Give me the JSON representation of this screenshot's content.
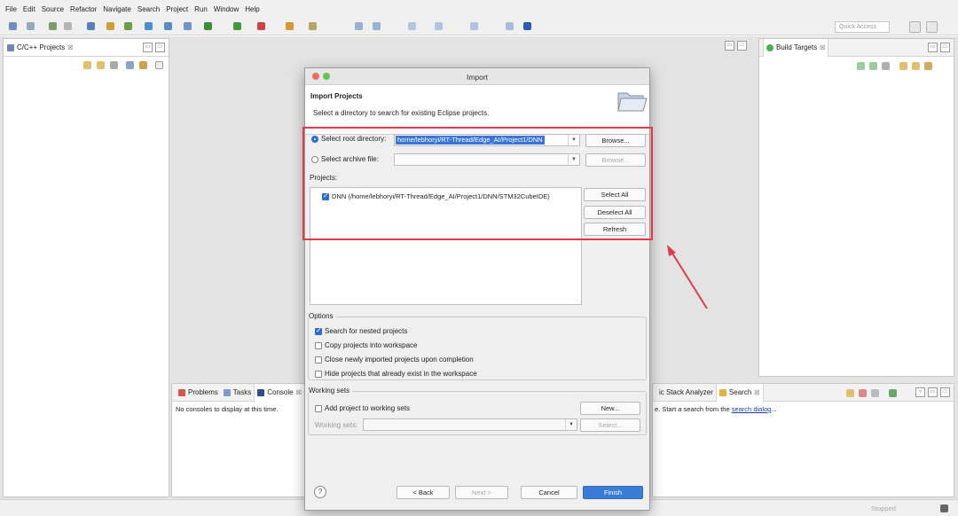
{
  "menubar": [
    "File",
    "Edit",
    "Source",
    "Refactor",
    "Navigate",
    "Search",
    "Project",
    "Run",
    "Window",
    "Help"
  ],
  "toolbar": {
    "quick_access_placeholder": "Quick Access"
  },
  "project_explorer": {
    "tab": "C/C++ Projects",
    "close": "☒"
  },
  "build_targets": {
    "tab": "Build Targets",
    "close": "☒"
  },
  "bottom_left": {
    "tabs": [
      "Problems",
      "Tasks",
      "Console"
    ],
    "active_tab": "Console",
    "empty_text": "No consoles to display at this time."
  },
  "bottom_right": {
    "tabs": [
      "ic Stack Analyzer",
      "Search"
    ],
    "text_prefix": "e. Start a search from the ",
    "link": "search dialog",
    "text_suffix": "..."
  },
  "status": {
    "text": "Stopped"
  },
  "dialog": {
    "title": "Import",
    "header_title": "Import Projects",
    "header_desc": "Select a directory to search for existing Eclipse projects.",
    "root_dir_label": "Select root directory:",
    "root_dir_value": "home/lebhoryi/RT-Thread/Edge_AI/Project1/DNN",
    "archive_label": "Select archive file:",
    "archive_value": "",
    "browse_label": "Browse...",
    "projects_label": "Projects:",
    "projects": [
      {
        "label": "DNN (/home/lebhoryi/RT-Thread/Edge_AI/Project1/DNN/STM32CubeIDE)",
        "checked": true
      }
    ],
    "select_all": "Select All",
    "deselect_all": "Deselect All",
    "refresh": "Refresh",
    "options_title": "Options",
    "options": [
      {
        "label": "Search for nested projects",
        "checked": true
      },
      {
        "label": "Copy projects into workspace",
        "checked": false
      },
      {
        "label": "Close newly imported projects upon completion",
        "checked": false
      },
      {
        "label": "Hide projects that already exist in the workspace",
        "checked": false
      }
    ],
    "working_sets_title": "Working sets",
    "add_to_ws_label": "Add project to working sets",
    "new_label": "New...",
    "working_sets_field_label": "Working sets:",
    "select_label": "Select...",
    "help_icon": "?",
    "back": "< Back",
    "next": "Next >",
    "cancel": "Cancel",
    "finish": "Finish"
  },
  "colors": {
    "accent": "#3a7bd5",
    "highlight_box": "#e23a4a"
  }
}
